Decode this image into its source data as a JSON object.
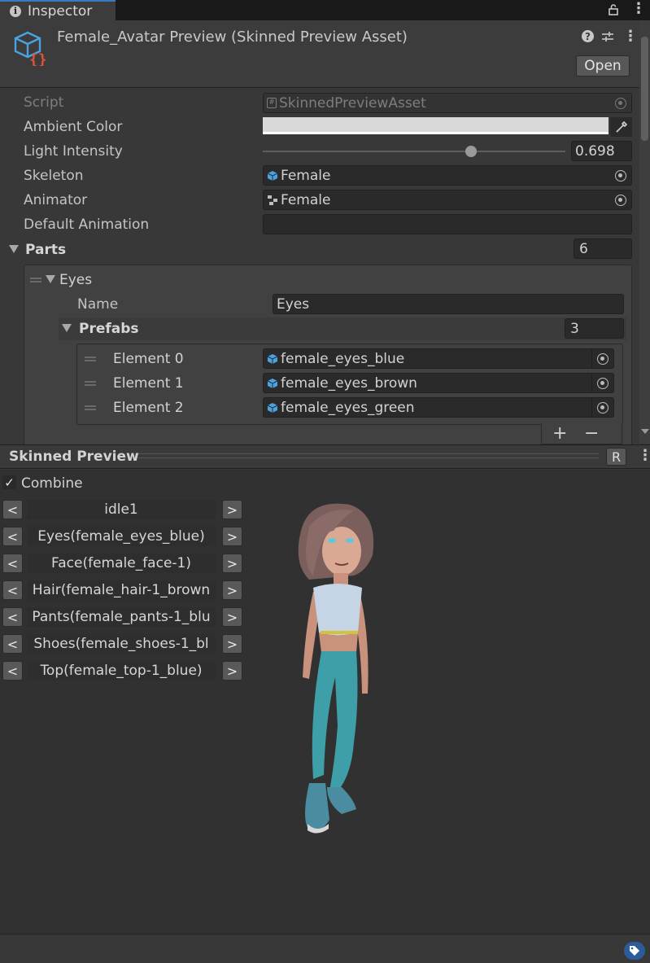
{
  "tab": {
    "label": "Inspector"
  },
  "header": {
    "title": "Female_Avatar Preview (Skinned Preview Asset)",
    "open_label": "Open"
  },
  "properties": {
    "script_label": "Script",
    "script_value": "SkinnedPreviewAsset",
    "ambient_label": "Ambient Color",
    "ambient_color": "#d9d9d9",
    "light_label": "Light Intensity",
    "light_value": "0.698",
    "light_fraction": 0.698,
    "skeleton_label": "Skeleton",
    "skeleton_value": "Female",
    "animator_label": "Animator",
    "animator_value": "Female",
    "default_anim_label": "Default Animation",
    "default_anim_value": ""
  },
  "parts": {
    "label": "Parts",
    "count": "6",
    "item": {
      "label": "Eyes",
      "name_label": "Name",
      "name_value": "Eyes",
      "prefabs_label": "Prefabs",
      "prefabs_count": "3",
      "elements": [
        {
          "label": "Element 0",
          "value": "female_eyes_blue"
        },
        {
          "label": "Element 1",
          "value": "female_eyes_brown"
        },
        {
          "label": "Element 2",
          "value": "female_eyes_green"
        }
      ],
      "add_label": "+",
      "remove_label": "−"
    }
  },
  "preview": {
    "title": "Skinned Preview",
    "r_label": "R",
    "combine_label": "Combine",
    "combine_checked": true,
    "prev_label": "<",
    "next_label": ">",
    "rows": [
      "idle1",
      "Eyes(female_eyes_blue)",
      "Face(female_face-1)",
      "Hair(female_hair-1_brown",
      "Pants(female_pants-1_blu",
      "Shoes(female_shoes-1_bl",
      "Top(female_top-1_blue)"
    ]
  },
  "colors": {
    "accent": "#3a79bb",
    "asset_orange": "#e0533a",
    "asset_blue": "#4aa3df"
  }
}
